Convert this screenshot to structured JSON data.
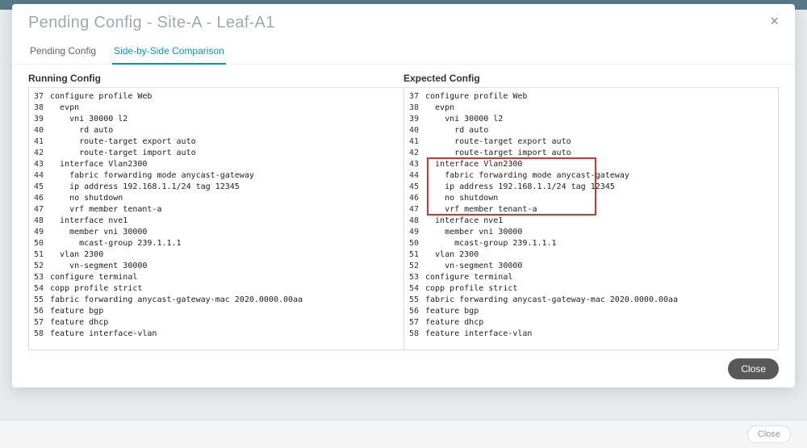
{
  "modal": {
    "title": "Pending Config - Site-A - Leaf-A1",
    "close_x": "×",
    "close_button": "Close"
  },
  "tabs": [
    {
      "label": "Pending Config",
      "active": false
    },
    {
      "label": "Side-by-Side Comparison",
      "active": true
    }
  ],
  "panes": {
    "running": {
      "title": "Running Config",
      "lines": [
        {
          "n": 37,
          "t": "configure profile Web"
        },
        {
          "n": 38,
          "t": "  evpn"
        },
        {
          "n": 39,
          "t": "    vni 30000 l2"
        },
        {
          "n": 40,
          "t": "      rd auto"
        },
        {
          "n": 41,
          "t": "      route-target export auto"
        },
        {
          "n": 42,
          "t": "      route-target import auto"
        },
        {
          "n": 43,
          "t": "  interface Vlan2300"
        },
        {
          "n": 44,
          "t": "    fabric forwarding mode anycast-gateway"
        },
        {
          "n": 45,
          "t": "    ip address 192.168.1.1/24 tag 12345"
        },
        {
          "n": 46,
          "t": "    no shutdown"
        },
        {
          "n": 47,
          "t": "    vrf member tenant-a"
        },
        {
          "n": 48,
          "t": "  interface nve1"
        },
        {
          "n": 49,
          "t": "    member vni 30000"
        },
        {
          "n": 50,
          "t": "      mcast-group 239.1.1.1"
        },
        {
          "n": 51,
          "t": "  vlan 2300"
        },
        {
          "n": 52,
          "t": "    vn-segment 30000"
        },
        {
          "n": 53,
          "t": "configure terminal"
        },
        {
          "n": 54,
          "t": "copp profile strict"
        },
        {
          "n": 55,
          "t": "fabric forwarding anycast-gateway-mac 2020.0000.00aa"
        },
        {
          "n": 56,
          "t": "feature bgp"
        },
        {
          "n": 57,
          "t": "feature dhcp"
        },
        {
          "n": 58,
          "t": "feature interface-vlan"
        }
      ]
    },
    "expected": {
      "title": "Expected Config",
      "highlight": {
        "start": 43,
        "end": 47
      },
      "lines": [
        {
          "n": 37,
          "t": "configure profile Web"
        },
        {
          "n": 38,
          "t": "  evpn"
        },
        {
          "n": 39,
          "t": "    vni 30000 l2"
        },
        {
          "n": 40,
          "t": "      rd auto"
        },
        {
          "n": 41,
          "t": "      route-target export auto"
        },
        {
          "n": 42,
          "t": "      route-target import auto"
        },
        {
          "n": 43,
          "t": "  interface Vlan2300"
        },
        {
          "n": 44,
          "t": "    fabric forwarding mode anycast-gateway"
        },
        {
          "n": 45,
          "t": "    ip address 192.168.1.1/24 tag 12345"
        },
        {
          "n": 46,
          "t": "    no shutdown"
        },
        {
          "n": 47,
          "t": "    vrf member tenant-a"
        },
        {
          "n": 48,
          "t": "  interface nve1"
        },
        {
          "n": 49,
          "t": "    member vni 30000"
        },
        {
          "n": 50,
          "t": "      mcast-group 239.1.1.1"
        },
        {
          "n": 51,
          "t": "  vlan 2300"
        },
        {
          "n": 52,
          "t": "    vn-segment 30000"
        },
        {
          "n": 53,
          "t": "configure terminal"
        },
        {
          "n": 54,
          "t": "copp profile strict"
        },
        {
          "n": 55,
          "t": "fabric forwarding anycast-gateway-mac 2020.0000.00aa"
        },
        {
          "n": 56,
          "t": "feature bgp"
        },
        {
          "n": 57,
          "t": "feature dhcp"
        },
        {
          "n": 58,
          "t": "feature interface-vlan"
        }
      ]
    }
  },
  "background_footer": {
    "close_label": "Close"
  }
}
